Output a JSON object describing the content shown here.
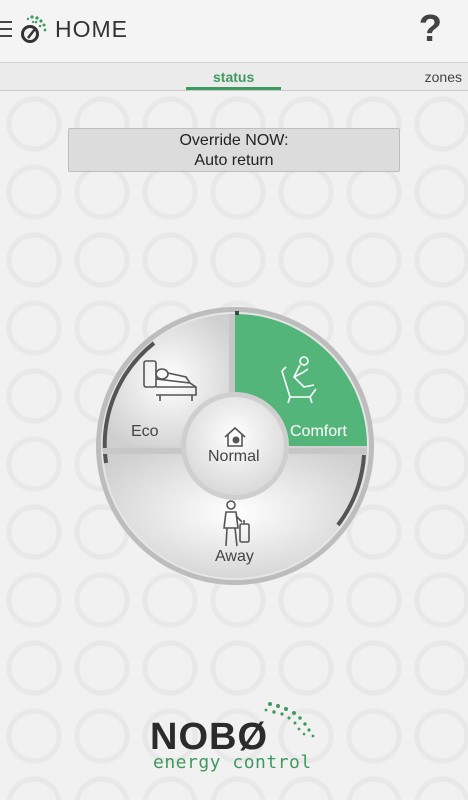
{
  "header": {
    "title": "HOME",
    "help_label": "?"
  },
  "tabs": {
    "status_label": "status",
    "zones_label": "zones"
  },
  "override": {
    "line1": "Override NOW:",
    "line2": "Auto return"
  },
  "dial": {
    "eco_label": "Eco",
    "comfort_label": "Comfort",
    "away_label": "Away",
    "normal_label": "Normal",
    "active_mode": "Comfort"
  },
  "brand": {
    "wordmark": "NOBØ",
    "tagline": "energy control"
  },
  "colors": {
    "accent": "#3f9a5f",
    "active_segment": "#54b57a"
  }
}
